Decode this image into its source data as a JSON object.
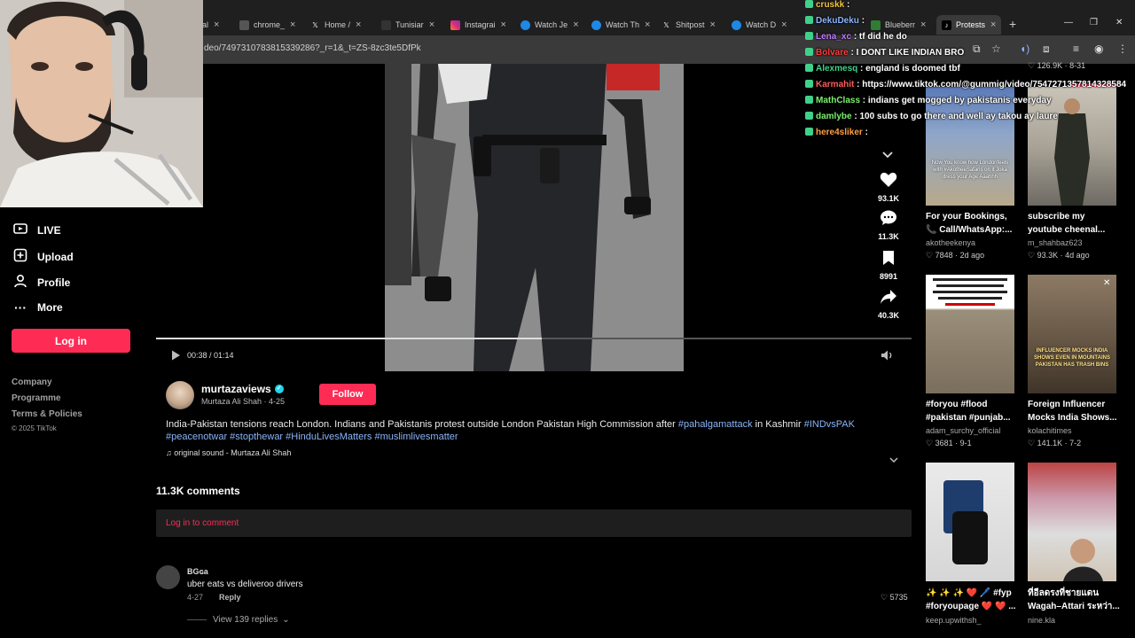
{
  "browser": {
    "tabs": [
      {
        "label": "al",
        "icon": "tab-icon"
      },
      {
        "label": "chrome_",
        "icon": "tab-icon"
      },
      {
        "label": "Home / ",
        "icon": "x-icon"
      },
      {
        "label": "Tunisiar",
        "icon": "tab-icon"
      },
      {
        "label": "Instagrai",
        "icon": "instagram-icon"
      },
      {
        "label": "Watch Je",
        "icon": "tab-icon"
      },
      {
        "label": "Watch Th",
        "icon": "tab-icon"
      },
      {
        "label": "Shitpost",
        "icon": "x-icon"
      },
      {
        "label": "Watch D",
        "icon": "tab-icon"
      },
      {
        "label": "Blueberr",
        "icon": "tab-icon"
      },
      {
        "label": "Protests",
        "icon": "tiktok-icon"
      }
    ],
    "url": "deo/7497310783815339286?_r=1&_t=ZS-8zc3te5DfPk"
  },
  "sidebar": {
    "items": [
      {
        "label": "LIVE",
        "icon": "live-icon"
      },
      {
        "label": "Upload",
        "icon": "upload-icon"
      },
      {
        "label": "Profile",
        "icon": "profile-icon"
      },
      {
        "label": "More",
        "icon": "more-icon"
      }
    ],
    "login_label": "Log in",
    "footer": [
      "Company",
      "Programme",
      "Terms & Policies"
    ],
    "copyright": "© 2025 TikTok"
  },
  "video": {
    "time": "00:38 / 01:14",
    "progress": 0.51,
    "actions": [
      {
        "name": "like",
        "count": "93.1K"
      },
      {
        "name": "comment",
        "count": "11.3K"
      },
      {
        "name": "bookmark",
        "count": "8991"
      },
      {
        "name": "share",
        "count": "40.3K"
      }
    ]
  },
  "post": {
    "username": "murtazaviews",
    "display_name": "Murtaza Ali Shah · 4-25",
    "follow_label": "Follow",
    "description": "India-Pakistan tensions reach London. Indians and Pakistanis protest outside London Pakistan High Commission after ",
    "tag1": "#pahalgamattack",
    "desc_mid": " in Kashmir ",
    "tag2": "#INDvsPAK",
    "tag3": "#peacenotwar",
    "tag4": "#stopthewar",
    "tag5": "#HinduLivesMatters",
    "tag6": "#muslimlivesmatter",
    "sound": "♫ original sound - Murtaza Ali Shah"
  },
  "comments": {
    "title": "11.3K comments",
    "login_prompt": "Log in to comment",
    "items": [
      {
        "user": "BGɢa",
        "text": "uber eats vs deliveroo drivers",
        "date": "4-27",
        "reply": "Reply",
        "likes": "5735",
        "view_replies": "View 139 replies"
      }
    ]
  },
  "recommendations": [
    {
      "title": "",
      "author": "",
      "meta": "126.9K · 8-31"
    },
    {
      "title": "For your Bookings, 📞 Call/WhatsApp:...",
      "author": "akotheekenya",
      "meta": "7848 · 2d ago",
      "overlay": "Now You know how Londonfeels with #AkotheeSafaris on it Joka dress your Age Aaahhh"
    },
    {
      "title": "subscribe my youtube cheenal...",
      "author": "m_shahbaz623",
      "meta": "93.3K · 4d ago"
    },
    {
      "title": "#foryou #flood #pakistan #punjab...",
      "author": "adam_surchy_official",
      "meta": "3681 · 9-1"
    },
    {
      "title": "Foreign Influencer Mocks India Shows...",
      "author": "kolachitimes",
      "meta": "141.1K · 7-2",
      "overlay": "INFLUENCER MOCKS INDIA SHOWS EVEN IN MOUNTAINS PAKISTAN HAS TRASH BINS"
    },
    {
      "title": "✨ ✨ ✨ ❤️ 🖊️ #fyp #foryoupage ❤️ ❤️ ...",
      "author": "keep.upwithsh_",
      "meta": ""
    },
    {
      "title": "ที่อีลดรงที่ชายแดน Wagah–Attari ระหว่า...",
      "author": "nine.kla",
      "meta": ""
    }
  ],
  "chat": [
    {
      "user": "cruskk",
      "msg": ":",
      "color": "#f5c542"
    },
    {
      "user": "DekuDeku",
      "msg": ":",
      "color": "#8ab4ff"
    },
    {
      "user": "Lena_xc",
      "msg": ": tf did he do",
      "color": "#c07cff"
    },
    {
      "user": "Bolvare",
      "msg": ": I DONT LIKE INDIAN BRO",
      "color": "#ff3b3b"
    },
    {
      "user": "Alexmesq",
      "msg": ": england is doomed tbf",
      "color": "#3fd18b"
    },
    {
      "user": "Karmahit",
      "msg": ": https://www.tiktok.com/@gummig/video/7547271357814328584",
      "color": "#ff5a5a"
    },
    {
      "user": "MathClass",
      "msg": ": indians get mogged by pakistanis everyday",
      "color": "#7cf06e"
    },
    {
      "user": "damlybe",
      "msg": ": 100 subs to go there and well ay takou ay laure",
      "color": "#7cf06e"
    },
    {
      "user": "here4sliker",
      "msg": ":",
      "color": "#ff9f40"
    }
  ],
  "rec_login_label": "Log in"
}
